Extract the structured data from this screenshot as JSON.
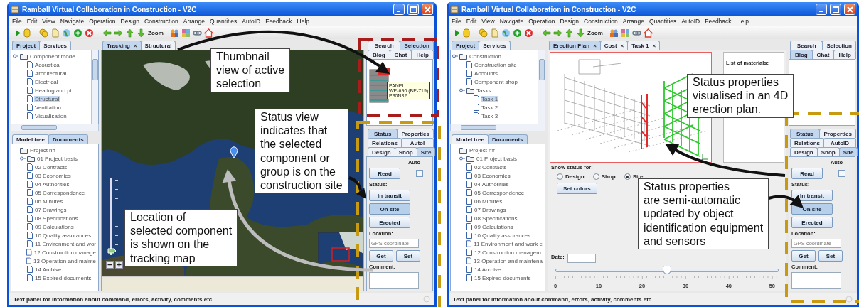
{
  "windows": [
    {
      "title": "Rambøll Virtual Collaboration in Construction - V2C",
      "menu": [
        "File",
        "Edit",
        "View",
        "Navigate",
        "Operation",
        "Design",
        "Construction",
        "Arrange",
        "Quantities",
        "AutoID",
        "Feedback",
        "Help"
      ],
      "toolbar": {
        "zoom_label": "Zoom"
      },
      "project_panel": {
        "tabs": [
          {
            "label": "Project",
            "selected": true
          },
          {
            "label": "Services",
            "selected": false
          }
        ],
        "tree": [
          {
            "label": "Component mode",
            "kind": "folder",
            "selected": false,
            "children": [
              {
                "label": "Acoustical",
                "kind": "document",
                "selected": false
              },
              {
                "label": "Architectural",
                "kind": "document",
                "selected": false
              },
              {
                "label": "Electrical",
                "kind": "document",
                "selected": false
              },
              {
                "label": "Heating and pi",
                "kind": "document",
                "selected": false
              },
              {
                "label": "Structural",
                "kind": "document",
                "selected": true
              },
              {
                "label": "Ventilation",
                "kind": "document",
                "selected": false
              },
              {
                "label": "Visualisation",
                "kind": "document",
                "selected": false
              }
            ]
          }
        ]
      },
      "documents_panel": {
        "tabs": [
          {
            "label": "Model tree",
            "selected": false
          },
          {
            "label": "Documents",
            "selected": true
          }
        ],
        "tree": [
          {
            "label": "Project n#",
            "kind": "root",
            "selected": false,
            "children": [
              {
                "label": "01 Project basis",
                "kind": "folder",
                "selected": false
              },
              {
                "label": "02 Contracts",
                "kind": "document",
                "selected": false
              },
              {
                "label": "03 Economies",
                "kind": "document",
                "selected": false
              },
              {
                "label": "04 Authorities",
                "kind": "document",
                "selected": false
              },
              {
                "label": "05 Correspondence",
                "kind": "document",
                "selected": false
              },
              {
                "label": "06 Minutes",
                "kind": "document",
                "selected": false
              },
              {
                "label": "07 Drawings",
                "kind": "document",
                "selected": false
              },
              {
                "label": "08 Specifications",
                "kind": "document",
                "selected": false
              },
              {
                "label": "09 Calculations",
                "kind": "document",
                "selected": false
              },
              {
                "label": "10 Quality assurances",
                "kind": "document",
                "selected": false
              },
              {
                "label": "11 Environment and wor",
                "kind": "document",
                "selected": false
              },
              {
                "label": "12 Construction manage",
                "kind": "document",
                "selected": false
              },
              {
                "label": "13 Operation and mainte",
                "kind": "document",
                "selected": false
              },
              {
                "label": "14 Archive",
                "kind": "document",
                "selected": false
              },
              {
                "label": "15 Expired documents",
                "kind": "document",
                "selected": false
              }
            ]
          }
        ]
      },
      "center": {
        "kind": "tracking",
        "tabs": [
          {
            "label": "Tracking",
            "close": "×",
            "selected": true
          },
          {
            "label": "Structural",
            "selected": false
          }
        ],
        "map": {
          "zoom": {
            "level": 0.05
          }
        }
      },
      "side_panel": {
        "upper_tabs": [
          [
            {
              "label": "Search",
              "selected": false
            },
            {
              "label": "Selection",
              "selected": true
            }
          ],
          [
            {
              "label": "Blog",
              "selected": false
            },
            {
              "label": "Chat",
              "selected": false
            },
            {
              "label": "Help",
              "selected": false
            }
          ]
        ],
        "thumbnail": {
          "tooltip": [
            "PANEL",
            "WE-690 (BE-719)",
            "P30N32"
          ]
        },
        "status_tabs": [
          [
            {
              "label": "Status",
              "selected": true
            },
            {
              "label": "Properties",
              "selected": false
            }
          ],
          [
            {
              "label": "Relations",
              "selected": false
            },
            {
              "label": "AutoI",
              "selected": false
            }
          ]
        ],
        "phase_tabs": [
          {
            "label": "Design",
            "selected": false
          },
          {
            "label": "Shop",
            "selected": false
          },
          {
            "label": "Site",
            "selected": true
          }
        ],
        "auto_label": "Auto",
        "auto_checked": false,
        "read_button": "Read",
        "status_label": "Status:",
        "status_buttons": [
          {
            "label": "In transit",
            "selected": false
          },
          {
            "label": "On site",
            "selected": true
          },
          {
            "label": "Erected",
            "selected": false
          }
        ],
        "location_label": "Location:",
        "location_placeholder": "GPS coordinate",
        "get_button": "Get",
        "set_button": "Set",
        "comment_label": "Comment:"
      },
      "status_bar": "Text panel for information about command, errors, activity, comments etc..."
    },
    {
      "title": "Rambøll Virtual Collaboration in Construction - V2C",
      "menu": [
        "File",
        "Edit",
        "View",
        "Navigate",
        "Operation",
        "Design",
        "Construction",
        "Arrange",
        "Quantities",
        "AutoID",
        "Feedback",
        "Help"
      ],
      "toolbar": {
        "zoom_label": "Zoom"
      },
      "project_panel": {
        "tabs": [
          {
            "label": "Project",
            "selected": true
          },
          {
            "label": "Services",
            "selected": false
          }
        ],
        "tree": [
          {
            "label": "Construction",
            "kind": "folder",
            "selected": false,
            "children": [
              {
                "label": "Construction site",
                "kind": "document",
                "selected": false
              },
              {
                "label": "Accounts",
                "kind": "document",
                "selected": false
              },
              {
                "label": "Component shop",
                "kind": "document",
                "selected": false
              },
              {
                "label": "Tasks",
                "kind": "folder",
                "selected": false,
                "children": [
                  {
                    "label": "Task 1",
                    "kind": "document",
                    "selected": true
                  },
                  {
                    "label": "Task 2",
                    "kind": "document",
                    "selected": false
                  },
                  {
                    "label": "Task 3",
                    "kind": "document",
                    "selected": false
                  }
                ]
              }
            ]
          }
        ]
      },
      "documents_panel": {
        "tabs": [
          {
            "label": "Model tree",
            "selected": false
          },
          {
            "label": "Documents",
            "selected": true
          }
        ],
        "tree": [
          {
            "label": "Project n#",
            "kind": "root",
            "selected": false,
            "children": [
              {
                "label": "01 Project basis",
                "kind": "folder",
                "selected": false
              },
              {
                "label": "02 Contracts",
                "kind": "document",
                "selected": false
              },
              {
                "label": "03 Economies",
                "kind": "document",
                "selected": false
              },
              {
                "label": "04 Authorities",
                "kind": "document",
                "selected": false
              },
              {
                "label": "05 Correspondence",
                "kind": "document",
                "selected": false
              },
              {
                "label": "06 Minutes",
                "kind": "document",
                "selected": false
              },
              {
                "label": "07 Drawings",
                "kind": "document",
                "selected": false
              },
              {
                "label": "08 Specifications",
                "kind": "document",
                "selected": false
              },
              {
                "label": "09 Calculations",
                "kind": "document",
                "selected": false
              },
              {
                "label": "10 Quality assurances",
                "kind": "document",
                "selected": false
              },
              {
                "label": "11 Environment and work e",
                "kind": "document",
                "selected": false
              },
              {
                "label": "12 Construction managem",
                "kind": "document",
                "selected": false
              },
              {
                "label": "13 Operation and maintena",
                "kind": "document",
                "selected": false
              },
              {
                "label": "14 Archive",
                "kind": "document",
                "selected": false
              },
              {
                "label": "15 Expired documents",
                "kind": "document",
                "selected": false
              }
            ]
          }
        ]
      },
      "center": {
        "kind": "erection_plan",
        "tabs": [
          {
            "label": "Erection Plan",
            "close": "×",
            "selected": true
          },
          {
            "label": "Cost",
            "close": "×",
            "selected": false
          },
          {
            "label": "Task 1",
            "close": "×",
            "selected": false
          }
        ],
        "materials_label": "List of materials:",
        "show_status_label": "Show status for:",
        "radios": [
          {
            "label": "Design",
            "selected": false
          },
          {
            "label": "Shop",
            "selected": false
          },
          {
            "label": "Site",
            "selected": true
          }
        ],
        "set_colors_button": "Set colors",
        "date_label": "Date:",
        "slider": {
          "level": 0.5,
          "ticks": [
            "0",
            "10",
            "20",
            "30",
            "40",
            "50"
          ]
        }
      },
      "side_panel": {
        "upper_tabs": [
          [
            {
              "label": "Search",
              "selected": false
            },
            {
              "label": "Selection",
              "selected": false
            }
          ],
          [
            {
              "label": "Blog",
              "selected": true
            },
            {
              "label": "Chat",
              "selected": false
            },
            {
              "label": "Help",
              "selected": false
            }
          ]
        ],
        "status_tabs": [
          [
            {
              "label": "Status",
              "selected": true
            },
            {
              "label": "Properties",
              "selected": false
            }
          ],
          [
            {
              "label": "Relations",
              "selected": false
            },
            {
              "label": "AutoID",
              "selected": false
            }
          ]
        ],
        "phase_tabs": [
          {
            "label": "Design",
            "selected": false
          },
          {
            "label": "Shop",
            "selected": false
          },
          {
            "label": "Site",
            "selected": true
          }
        ],
        "auto_label": "Auto",
        "auto_checked": false,
        "read_button": "Read",
        "status_label": "Status:",
        "status_buttons": [
          {
            "label": "In transit",
            "selected": false
          },
          {
            "label": "On site",
            "selected": true
          },
          {
            "label": "Erected",
            "selected": false
          }
        ],
        "location_label": "Location:",
        "location_placeholder": "GPS coordinate",
        "get_button": "Get",
        "set_button": "Set",
        "comment_label": "Comment:"
      },
      "status_bar": "Text panel for information about command, errors, activity, comments etc..."
    }
  ],
  "callouts": [
    {
      "text": "Thumbnail\nview of active\nselection"
    },
    {
      "text": "Status view\nindicates that\nthe selected\ncomponent or\ngroup is on the\nconstruction site"
    },
    {
      "text": "Location of\nselected component\nis shown on the\ntracking map"
    },
    {
      "text": "Status properties\nvisualised in an 4D\nerection plan."
    },
    {
      "text": "Status properties\nare semi-automatic\nupdated by object\nidentification equipment\nand sensors"
    }
  ]
}
